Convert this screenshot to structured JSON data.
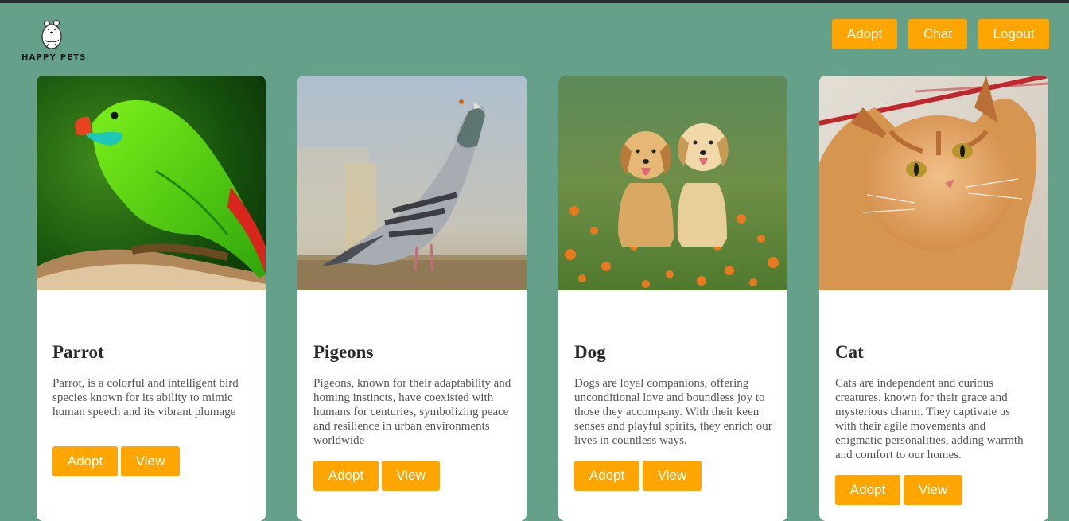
{
  "brand": {
    "name": "HAPPY PETS",
    "icon": "bear-logo-icon"
  },
  "nav": {
    "adopt": "Adopt",
    "chat": "Chat",
    "logout": "Logout"
  },
  "colors": {
    "background": "#65a18a",
    "accent": "#ffa500",
    "card": "#ffffff"
  },
  "cards": [
    {
      "title": "Parrot",
      "description": "Parrot, is a colorful and intelligent bird species known for its ability to mimic human speech and its vibrant plumage",
      "adopt": "Adopt",
      "view": "View",
      "image": "parrot-photo"
    },
    {
      "title": "Pigeons",
      "description": "Pigeons, known for their adaptability and homing instincts, have coexisted with humans for centuries, symbolizing peace and resilience in urban environments worldwide",
      "adopt": "Adopt",
      "view": "View",
      "image": "pigeon-photo"
    },
    {
      "title": "Dog",
      "description": "Dogs are loyal companions, offering unconditional love and boundless joy to those they accompany. With their keen senses and playful spirits, they enrich our lives in countless ways.",
      "adopt": "Adopt",
      "view": "View",
      "image": "puppies-photo"
    },
    {
      "title": "Cat",
      "description": "Cats are independent and curious creatures, known for their grace and mysterious charm. They captivate us with their agile movements and enigmatic personalities, adding warmth and comfort to our homes.",
      "adopt": "Adopt",
      "view": "View",
      "image": "cat-photo"
    }
  ]
}
